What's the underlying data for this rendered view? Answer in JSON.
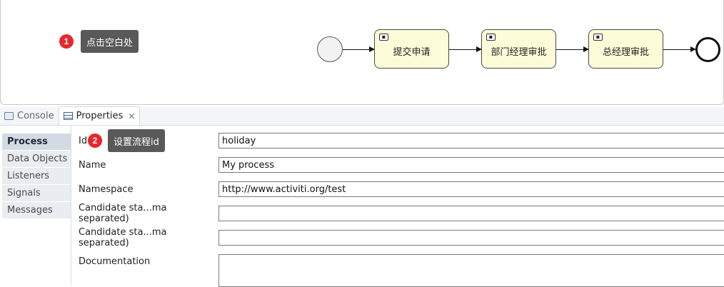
{
  "diagram": {
    "callout1": {
      "number": "1",
      "text": "点击空白处"
    },
    "tasks": [
      {
        "label": "提交申请"
      },
      {
        "label": "部门经理审批"
      },
      {
        "label": "总经理审批"
      }
    ]
  },
  "tabs": [
    {
      "label": "Console",
      "icon": "console-icon"
    },
    {
      "label": "Properties",
      "icon": "table-icon",
      "close": "✕"
    }
  ],
  "sidenav": [
    {
      "label": "Process"
    },
    {
      "label": "Data Objects"
    },
    {
      "label": "Listeners"
    },
    {
      "label": "Signals"
    },
    {
      "label": "Messages"
    }
  ],
  "callout2": {
    "number": "2",
    "text": "设置流程id"
  },
  "form": {
    "id": {
      "label": "Id",
      "value": "holiday"
    },
    "name": {
      "label": "Name",
      "value": "My process"
    },
    "namespace": {
      "label": "Namespace",
      "value": "http://www.activiti.org/test"
    },
    "candidate1": {
      "label": "Candidate sta...ma separated)",
      "value": ""
    },
    "candidate2": {
      "label": "Candidate sta...ma separated)",
      "value": ""
    },
    "documentation": {
      "label": "Documentation",
      "value": ""
    }
  },
  "colors": {
    "badge": "#e8262b",
    "tooltip": "#595959",
    "task_fill": "#fcfcd8"
  }
}
